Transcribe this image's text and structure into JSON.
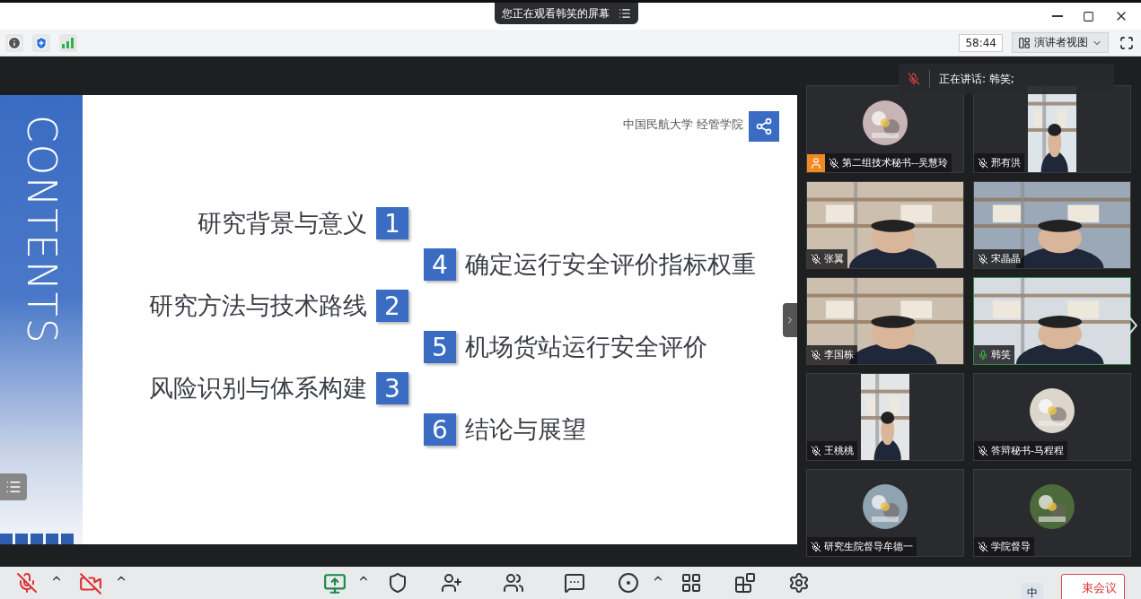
{
  "banner": {
    "text": "您正在观看韩笑的屏幕"
  },
  "toolbar": {
    "timer": "58:44",
    "view_button": "演讲者视图"
  },
  "slide": {
    "side_title": "CONTENTS",
    "org": "中国民航大学 经管学院",
    "left_items": [
      {
        "number": "1",
        "label": "研究背景与意义"
      },
      {
        "number": "2",
        "label": "研究方法与技术路线"
      },
      {
        "number": "3",
        "label": "风险识别与体系构建"
      }
    ],
    "right_items": [
      {
        "number": "4",
        "label": "确定运行安全评价指标权重"
      },
      {
        "number": "5",
        "label": "机场货站运行安全评价"
      },
      {
        "number": "6",
        "label": "结论与展望"
      }
    ]
  },
  "speaking_toast": {
    "text": "正在讲话: 韩笑;"
  },
  "participants": [
    {
      "name": "第二组技术秘书--吴慧玲",
      "kind": "avatar",
      "muted": true,
      "speaking": false,
      "host_badge": true
    },
    {
      "name": "邢有洪",
      "kind": "video",
      "portrait": true,
      "muted": true,
      "speaking": false
    },
    {
      "name": "张翼",
      "kind": "video",
      "muted": true,
      "speaking": false
    },
    {
      "name": "宋晶晶",
      "kind": "video",
      "muted": true,
      "speaking": false
    },
    {
      "name": "李国栋",
      "kind": "video",
      "muted": true,
      "speaking": false
    },
    {
      "name": "韩笑",
      "kind": "video",
      "muted": false,
      "speaking": true
    },
    {
      "name": "王桃桃",
      "kind": "video",
      "portrait": true,
      "muted": true,
      "speaking": false
    },
    {
      "name": "答辩秘书-马程程",
      "kind": "avatar",
      "muted": true,
      "speaking": false
    },
    {
      "name": "研究生院督导牟德一",
      "kind": "avatar",
      "muted": true,
      "speaking": false
    },
    {
      "name": "学院督导",
      "kind": "avatar",
      "muted": true,
      "speaking": false
    }
  ],
  "bottom_bar": {
    "end_button": "束会议",
    "ime_label": "中"
  }
}
